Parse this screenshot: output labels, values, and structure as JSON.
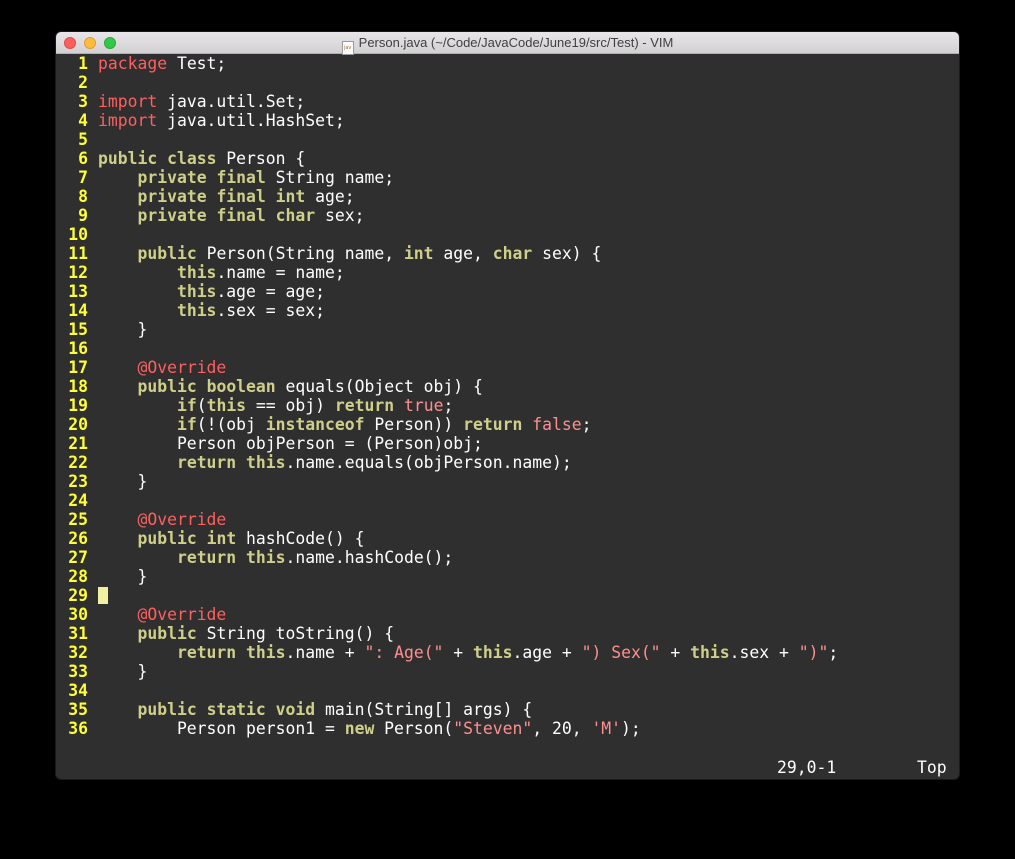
{
  "window": {
    "title": "Person.java (~/Code/JavaCode/June19/src/Test) - VIM",
    "file_icon": "java-file-icon"
  },
  "editor": {
    "lines": [
      {
        "n": "1",
        "tokens": [
          [
            "package",
            "p"
          ],
          [
            " Test;",
            ""
          ]
        ]
      },
      {
        "n": "2",
        "tokens": []
      },
      {
        "n": "3",
        "tokens": [
          [
            "import",
            "p"
          ],
          [
            " java.util.Set;",
            ""
          ]
        ]
      },
      {
        "n": "4",
        "tokens": [
          [
            "import",
            "p"
          ],
          [
            " java.util.HashSet;",
            ""
          ]
        ]
      },
      {
        "n": "5",
        "tokens": []
      },
      {
        "n": "6",
        "tokens": [
          [
            "public",
            "k"
          ],
          [
            " ",
            ""
          ],
          [
            "class",
            "k"
          ],
          [
            " Person {",
            ""
          ]
        ]
      },
      {
        "n": "7",
        "tokens": [
          [
            "    ",
            ""
          ],
          [
            "private",
            "k"
          ],
          [
            " ",
            ""
          ],
          [
            "final",
            "k"
          ],
          [
            " String name;",
            ""
          ]
        ]
      },
      {
        "n": "8",
        "tokens": [
          [
            "    ",
            ""
          ],
          [
            "private",
            "k"
          ],
          [
            " ",
            ""
          ],
          [
            "final",
            "k"
          ],
          [
            " ",
            ""
          ],
          [
            "int",
            "k"
          ],
          [
            " age;",
            ""
          ]
        ]
      },
      {
        "n": "9",
        "tokens": [
          [
            "    ",
            ""
          ],
          [
            "private",
            "k"
          ],
          [
            " ",
            ""
          ],
          [
            "final",
            "k"
          ],
          [
            " ",
            ""
          ],
          [
            "char",
            "k"
          ],
          [
            " sex;",
            ""
          ]
        ]
      },
      {
        "n": "10",
        "tokens": []
      },
      {
        "n": "11",
        "tokens": [
          [
            "    ",
            ""
          ],
          [
            "public",
            "k"
          ],
          [
            " Person(String name, ",
            ""
          ],
          [
            "int",
            "k"
          ],
          [
            " age, ",
            ""
          ],
          [
            "char",
            "k"
          ],
          [
            " sex) {",
            ""
          ]
        ]
      },
      {
        "n": "12",
        "tokens": [
          [
            "        ",
            ""
          ],
          [
            "this",
            "k"
          ],
          [
            ".name = name;",
            ""
          ]
        ]
      },
      {
        "n": "13",
        "tokens": [
          [
            "        ",
            ""
          ],
          [
            "this",
            "k"
          ],
          [
            ".age = age;",
            ""
          ]
        ]
      },
      {
        "n": "14",
        "tokens": [
          [
            "        ",
            ""
          ],
          [
            "this",
            "k"
          ],
          [
            ".sex = sex;",
            ""
          ]
        ]
      },
      {
        "n": "15",
        "tokens": [
          [
            "    }",
            ""
          ]
        ]
      },
      {
        "n": "16",
        "tokens": []
      },
      {
        "n": "17",
        "tokens": [
          [
            "    ",
            ""
          ],
          [
            "@Override",
            "p"
          ]
        ]
      },
      {
        "n": "18",
        "tokens": [
          [
            "    ",
            ""
          ],
          [
            "public",
            "k"
          ],
          [
            " ",
            ""
          ],
          [
            "boolean",
            "k"
          ],
          [
            " equals(Object obj) {",
            ""
          ]
        ]
      },
      {
        "n": "19",
        "tokens": [
          [
            "        ",
            ""
          ],
          [
            "if",
            "k"
          ],
          [
            "(",
            ""
          ],
          [
            "this",
            "k"
          ],
          [
            " == obj) ",
            ""
          ],
          [
            "return",
            "k"
          ],
          [
            " ",
            ""
          ],
          [
            "true",
            "s"
          ],
          [
            ";",
            ""
          ]
        ]
      },
      {
        "n": "20",
        "tokens": [
          [
            "        ",
            ""
          ],
          [
            "if",
            "k"
          ],
          [
            "(!(obj ",
            ""
          ],
          [
            "instanceof",
            "k"
          ],
          [
            " Person)) ",
            ""
          ],
          [
            "return",
            "k"
          ],
          [
            " ",
            ""
          ],
          [
            "false",
            "s"
          ],
          [
            ";",
            ""
          ]
        ]
      },
      {
        "n": "21",
        "tokens": [
          [
            "        Person objPerson = (Person)obj;",
            ""
          ]
        ]
      },
      {
        "n": "22",
        "tokens": [
          [
            "        ",
            ""
          ],
          [
            "return",
            "k"
          ],
          [
            " ",
            ""
          ],
          [
            "this",
            "k"
          ],
          [
            ".name.equals(objPerson.name);",
            ""
          ]
        ]
      },
      {
        "n": "23",
        "tokens": [
          [
            "    }",
            ""
          ]
        ]
      },
      {
        "n": "24",
        "tokens": []
      },
      {
        "n": "25",
        "tokens": [
          [
            "    ",
            ""
          ],
          [
            "@Override",
            "p"
          ]
        ]
      },
      {
        "n": "26",
        "tokens": [
          [
            "    ",
            ""
          ],
          [
            "public",
            "k"
          ],
          [
            " ",
            ""
          ],
          [
            "int",
            "k"
          ],
          [
            " hashCode() {",
            ""
          ]
        ]
      },
      {
        "n": "27",
        "tokens": [
          [
            "        ",
            ""
          ],
          [
            "return",
            "k"
          ],
          [
            " ",
            ""
          ],
          [
            "this",
            "k"
          ],
          [
            ".name.hashCode();",
            ""
          ]
        ]
      },
      {
        "n": "28",
        "tokens": [
          [
            "    }",
            ""
          ]
        ]
      },
      {
        "n": "29",
        "tokens": [],
        "cursor": true
      },
      {
        "n": "30",
        "tokens": [
          [
            "    ",
            ""
          ],
          [
            "@Override",
            "p"
          ]
        ]
      },
      {
        "n": "31",
        "tokens": [
          [
            "    ",
            ""
          ],
          [
            "public",
            "k"
          ],
          [
            " String toString() {",
            ""
          ]
        ]
      },
      {
        "n": "32",
        "tokens": [
          [
            "        ",
            ""
          ],
          [
            "return",
            "k"
          ],
          [
            " ",
            ""
          ],
          [
            "this",
            "k"
          ],
          [
            ".name + ",
            ""
          ],
          [
            "\": Age(\"",
            "s"
          ],
          [
            " + ",
            ""
          ],
          [
            "this",
            "k"
          ],
          [
            ".age + ",
            ""
          ],
          [
            "\") Sex(\"",
            "s"
          ],
          [
            " + ",
            ""
          ],
          [
            "this",
            "k"
          ],
          [
            ".sex + ",
            ""
          ],
          [
            "\")\"",
            "s"
          ],
          [
            ";",
            ""
          ]
        ]
      },
      {
        "n": "33",
        "tokens": [
          [
            "    }",
            ""
          ]
        ]
      },
      {
        "n": "34",
        "tokens": []
      },
      {
        "n": "35",
        "tokens": [
          [
            "    ",
            ""
          ],
          [
            "public",
            "k"
          ],
          [
            " ",
            ""
          ],
          [
            "static",
            "k"
          ],
          [
            " ",
            ""
          ],
          [
            "void",
            "k"
          ],
          [
            " main(String[] args) {",
            ""
          ]
        ]
      },
      {
        "n": "36",
        "tokens": [
          [
            "        Person person1 = ",
            ""
          ],
          [
            "new",
            "k"
          ],
          [
            " Person(",
            ""
          ],
          [
            "\"Steven\"",
            "s"
          ],
          [
            ", 20, ",
            ""
          ],
          [
            "'M'",
            "s"
          ],
          [
            ");",
            ""
          ]
        ]
      }
    ]
  },
  "statusbar": {
    "position": "29,0-1",
    "scroll": "Top"
  },
  "colors": {
    "background": "#2f2f2f",
    "line_number": "#ffff36",
    "keyword": "#cfcf8a",
    "preproc": "#ff5f5f",
    "string": "#ff8f8f",
    "cursor": "#f0f0a0"
  }
}
